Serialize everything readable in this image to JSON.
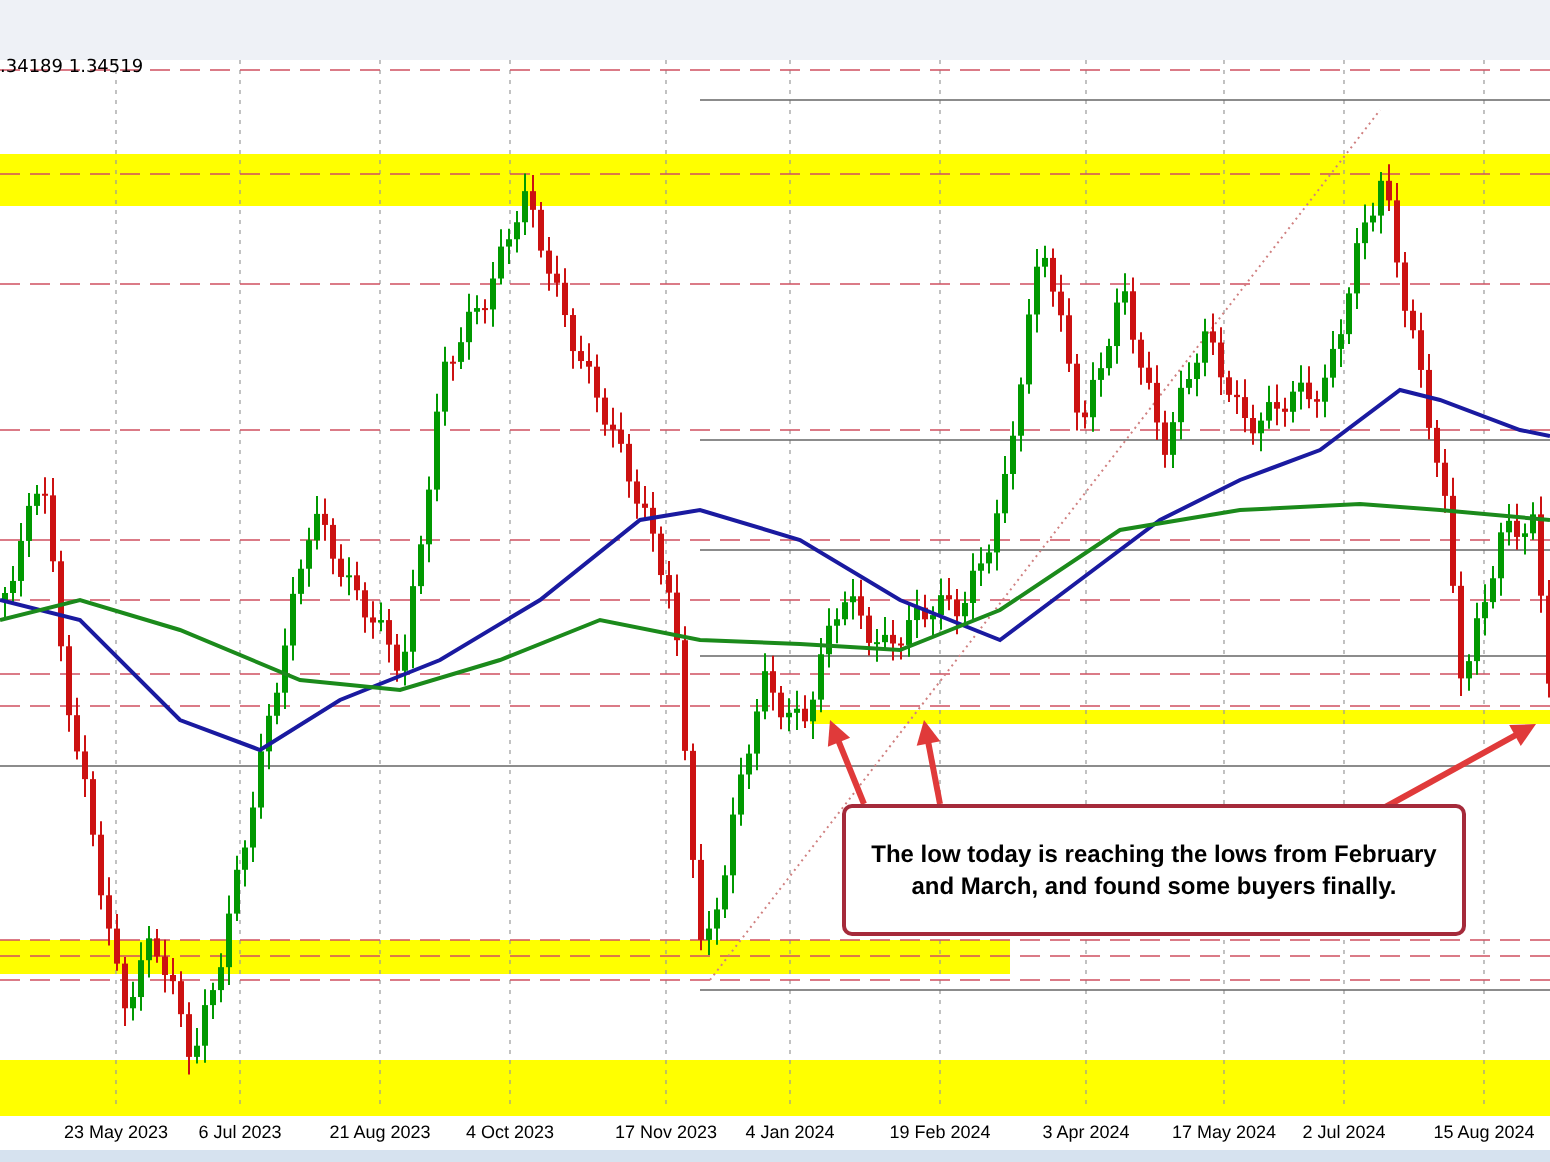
{
  "price_readout": ".34189 1.34519",
  "x_axis_labels": [
    "23 May 2023",
    "6 Jul 2023",
    "21 Aug 2023",
    "4 Oct 2023",
    "17 Nov 2023",
    "4 Jan 2024",
    "19 Feb 2024",
    "3 Apr 2024",
    "17 May 2024",
    "2 Jul 2024",
    "15 Aug 2024"
  ],
  "annotation": {
    "text": "The low today is reaching the lows from February and March, and found some buyers finally."
  }
}
